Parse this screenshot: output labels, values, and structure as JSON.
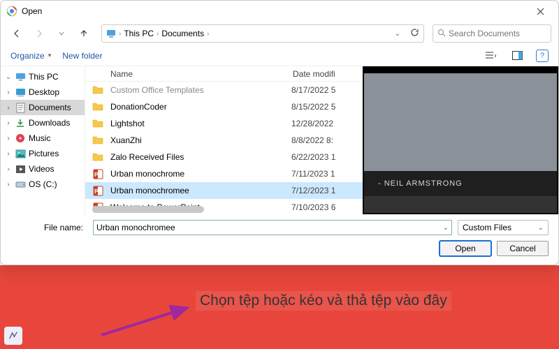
{
  "window": {
    "title": "Open"
  },
  "nav": {
    "crumbs": [
      "This PC",
      "Documents"
    ],
    "search_placeholder": "Search Documents"
  },
  "toolbar": {
    "organize": "Organize",
    "new_folder": "New folder"
  },
  "sidebar": {
    "items": [
      {
        "label": "This PC",
        "icon": "pc",
        "expanded": true,
        "selected": false
      },
      {
        "label": "Desktop",
        "icon": "desktop",
        "expanded": false,
        "selected": false
      },
      {
        "label": "Documents",
        "icon": "docs",
        "expanded": false,
        "selected": true
      },
      {
        "label": "Downloads",
        "icon": "downloads",
        "expanded": false,
        "selected": false
      },
      {
        "label": "Music",
        "icon": "music",
        "expanded": false,
        "selected": false
      },
      {
        "label": "Pictures",
        "icon": "pictures",
        "expanded": false,
        "selected": false
      },
      {
        "label": "Videos",
        "icon": "videos",
        "expanded": false,
        "selected": false
      },
      {
        "label": "OS (C:)",
        "icon": "drive",
        "expanded": false,
        "selected": false
      }
    ]
  },
  "columns": {
    "name": "Name",
    "date": "Date modifi"
  },
  "files": [
    {
      "name": "Custom Office Templates",
      "date": "8/17/2022 5",
      "type": "folder",
      "truncated": true
    },
    {
      "name": "DonationCoder",
      "date": "8/15/2022 5",
      "type": "folder"
    },
    {
      "name": "Lightshot",
      "date": "12/28/2022",
      "type": "folder"
    },
    {
      "name": "XuanZhi",
      "date": "8/8/2022 8:",
      "type": "folder"
    },
    {
      "name": "Zalo Received Files",
      "date": "6/22/2023 1",
      "type": "folder"
    },
    {
      "name": "Urban monochrome",
      "date": "7/11/2023 1",
      "type": "ppt"
    },
    {
      "name": "Urban monochromee",
      "date": "7/12/2023 1",
      "type": "ppt",
      "selected": true
    },
    {
      "name": "Welcome to PowerPoint",
      "date": "7/10/2023 6",
      "type": "ppt"
    }
  ],
  "preview": {
    "caption": "- NEIL ARMSTRONG"
  },
  "footer": {
    "filename_label": "File name:",
    "filename_value": "Urban monochromee",
    "filter": "Custom Files",
    "open": "Open",
    "cancel": "Cancel"
  },
  "backdrop": {
    "text": "Chọn tệp hoặc kéo và thả tệp vào đây"
  }
}
